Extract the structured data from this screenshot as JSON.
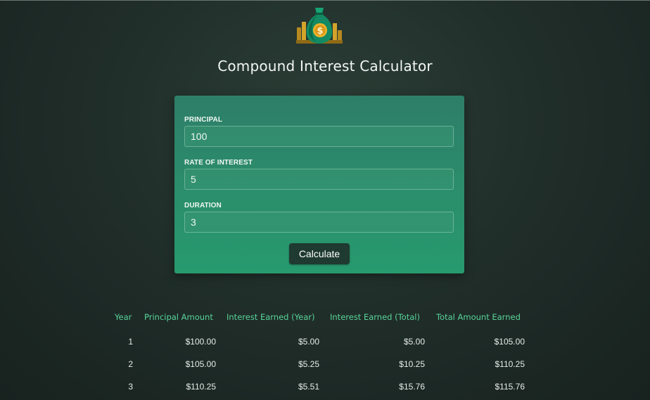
{
  "app": {
    "title": "Compound Interest Calculator"
  },
  "form": {
    "principal_label": "PRINCIPAL",
    "principal_value": "100",
    "rate_label": "RATE OF INTEREST",
    "rate_value": "5",
    "duration_label": "DURATION",
    "duration_value": "3",
    "calculate_label": "Calculate"
  },
  "table": {
    "headers": [
      "Year",
      "Principal Amount",
      "Interest Earned (Year)",
      "Interest Earned (Total)",
      "Total Amount Earned"
    ],
    "rows": [
      [
        "1",
        "$100.00",
        "$5.00",
        "$5.00",
        "$105.00"
      ],
      [
        "2",
        "$105.00",
        "$5.25",
        "$10.25",
        "$110.25"
      ],
      [
        "3",
        "$110.25",
        "$5.51",
        "$15.76",
        "$115.76"
      ]
    ]
  },
  "colors": {
    "accent": "#2b8e6c",
    "header_text": "#58d49a",
    "button": "#1f3a31"
  },
  "icons": {
    "logo": "money-bag-icon"
  }
}
